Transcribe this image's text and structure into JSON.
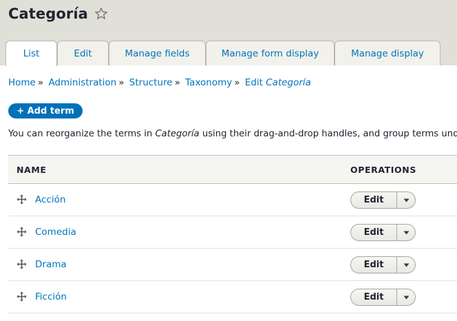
{
  "header": {
    "title": "Categoría",
    "star_icon": "star-outline-icon"
  },
  "tabs": [
    {
      "label": "List",
      "active": true
    },
    {
      "label": "Edit",
      "active": false
    },
    {
      "label": "Manage fields",
      "active": false
    },
    {
      "label": "Manage form display",
      "active": false
    },
    {
      "label": "Manage display",
      "active": false
    }
  ],
  "breadcrumb": {
    "items": [
      "Home",
      "Administration",
      "Structure",
      "Taxonomy"
    ],
    "separator": "»",
    "current_prefix": "Edit ",
    "current_term": "Categoría"
  },
  "actions": {
    "add_term_label": "+ Add term"
  },
  "description": {
    "before": "You can reorganize the terms in ",
    "vocabulary": "Categoría",
    "after": " using their drag-and-drop handles, and group terms under"
  },
  "table": {
    "headers": {
      "name": "NAME",
      "operations": "OPERATIONS"
    },
    "rows": [
      {
        "name": "Acción",
        "operation": "Edit"
      },
      {
        "name": "Comedia",
        "operation": "Edit"
      },
      {
        "name": "Drama",
        "operation": "Edit"
      },
      {
        "name": "Ficción",
        "operation": "Edit"
      }
    ]
  },
  "colors": {
    "link": "#0074bd",
    "header_bg": "#e0e0d8",
    "primary_button": "#0071b8"
  }
}
